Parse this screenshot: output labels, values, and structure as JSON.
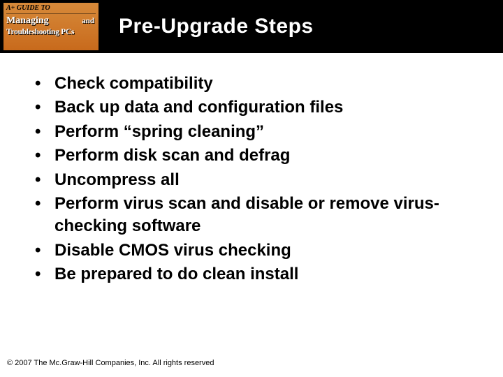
{
  "logo": {
    "topline": "A+ GUIDE TO",
    "line1": "Managing",
    "and": "and",
    "line2": "Troubleshooting PCs"
  },
  "title": "Pre-Upgrade Steps",
  "bullets": [
    "Check compatibility",
    "Back up data and configuration files",
    "Perform “spring cleaning”",
    "Perform disk scan and defrag",
    "Uncompress all",
    "Perform virus scan and disable or remove virus-checking software",
    "Disable CMOS virus checking",
    "Be prepared to do clean install"
  ],
  "footer": "© 2007 The Mc.Graw-Hill Companies, Inc. All rights reserved"
}
